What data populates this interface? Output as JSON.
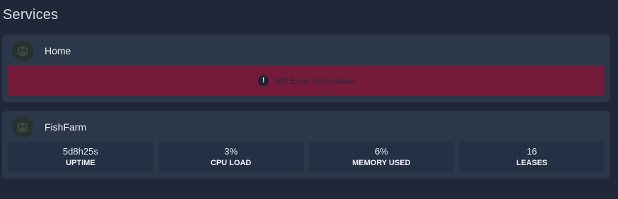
{
  "section": {
    "title": "Services"
  },
  "services": [
    {
      "name": "Home",
      "icon": "mikrotik-logo-icon",
      "error": {
        "icon": "exclamation-icon",
        "text": "API Error Information"
      }
    },
    {
      "name": "FishFarm",
      "icon": "mikrotik-logo-icon",
      "stats": [
        {
          "value": "5d8h25s",
          "label": "UPTIME"
        },
        {
          "value": "3%",
          "label": "CPU LOAD"
        },
        {
          "value": "6%",
          "label": "MEMORY USED"
        },
        {
          "value": "16",
          "label": "LEASES"
        }
      ]
    }
  ],
  "colors": {
    "background": "#1f2738",
    "card": "#2c3749",
    "stat_block": "#243044",
    "error_bar": "#741b3a"
  }
}
